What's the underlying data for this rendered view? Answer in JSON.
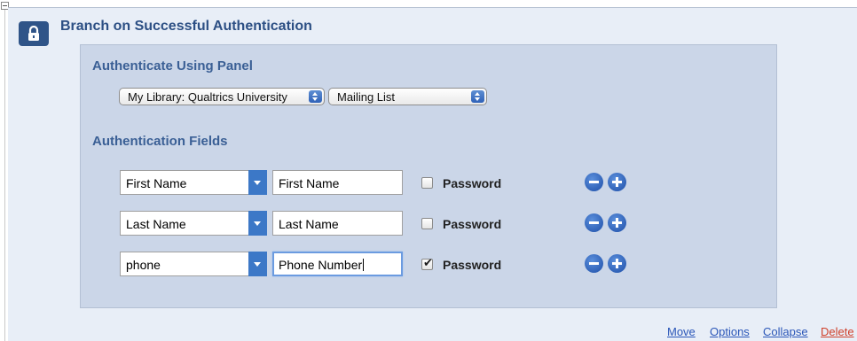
{
  "block": {
    "title": "Branch on Successful Authentication"
  },
  "panel": {
    "heading": "Authenticate Using Panel",
    "library_select": "My Library: Qualtrics University",
    "panel_select": "Mailing List",
    "fields_heading": "Authentication Fields"
  },
  "fields": [
    {
      "select": "First Name",
      "input": "First Name",
      "password_label": "Password",
      "password_checked": false
    },
    {
      "select": "Last Name",
      "input": "Last Name",
      "password_label": "Password",
      "password_checked": false
    },
    {
      "select": "phone",
      "input": "Phone Number",
      "password_label": "Password",
      "password_checked": true
    }
  ],
  "footer": {
    "move": "Move",
    "options": "Options",
    "collapse": "Collapse",
    "delete": "Delete"
  },
  "icons": {
    "lock": "lock-icon",
    "remove": "minus-circle-icon",
    "add": "plus-circle-icon"
  },
  "colors": {
    "title_blue": "#2c4f84",
    "panel_bg": "#cbd6e8",
    "link_blue": "#2a56b8",
    "delete_red": "#d0402a"
  }
}
